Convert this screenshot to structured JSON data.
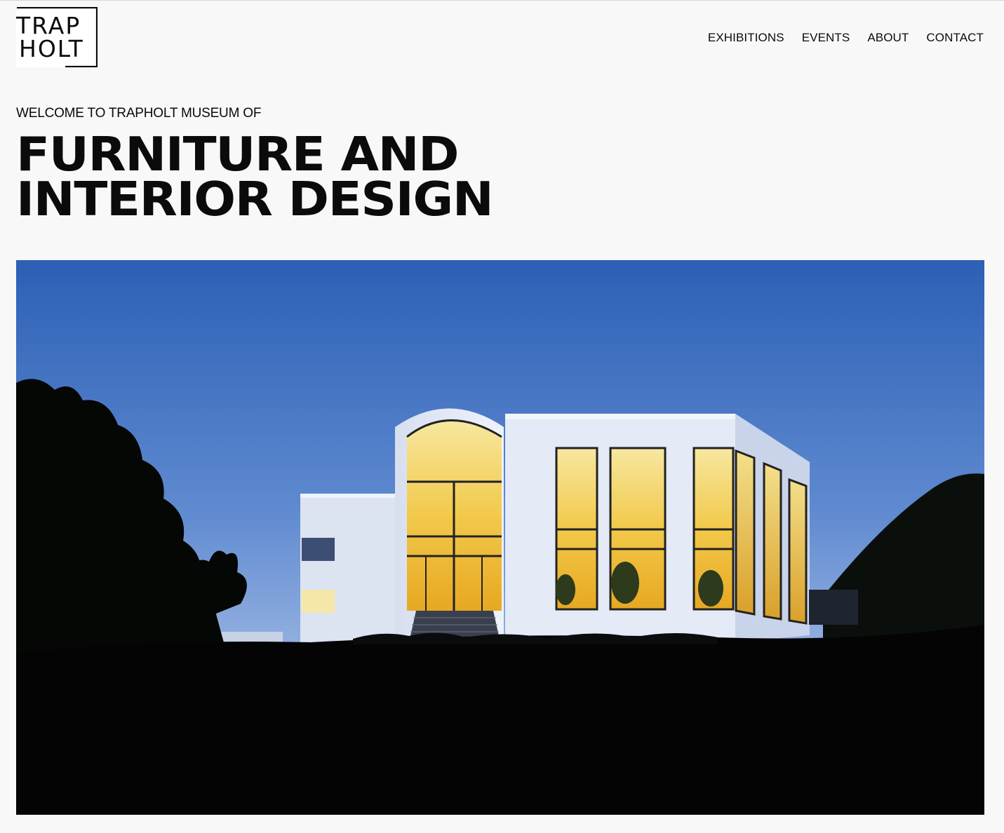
{
  "logo": {
    "line1": "TRAP",
    "line2": "HOLT"
  },
  "nav": {
    "items": [
      {
        "label": "EXHIBITIONS"
      },
      {
        "label": "EVENTS"
      },
      {
        "label": "ABOUT"
      },
      {
        "label": "CONTACT"
      }
    ]
  },
  "hero": {
    "eyebrow": "WELCOME TO TRAPHOLT MUSEUM OF",
    "headline_line1": "FURNITURE AND",
    "headline_line2": "INTERIOR DESIGN",
    "image_alt": "Trapholt museum building at dusk with illuminated windows"
  },
  "colors": {
    "background": "#f8f8f8",
    "text": "#0b0b0b",
    "sky_top": "#2f63b8",
    "sky_horizon": "#a8bfe6",
    "window_light": "#f2c53a",
    "building_wall": "#dfe6f3"
  }
}
